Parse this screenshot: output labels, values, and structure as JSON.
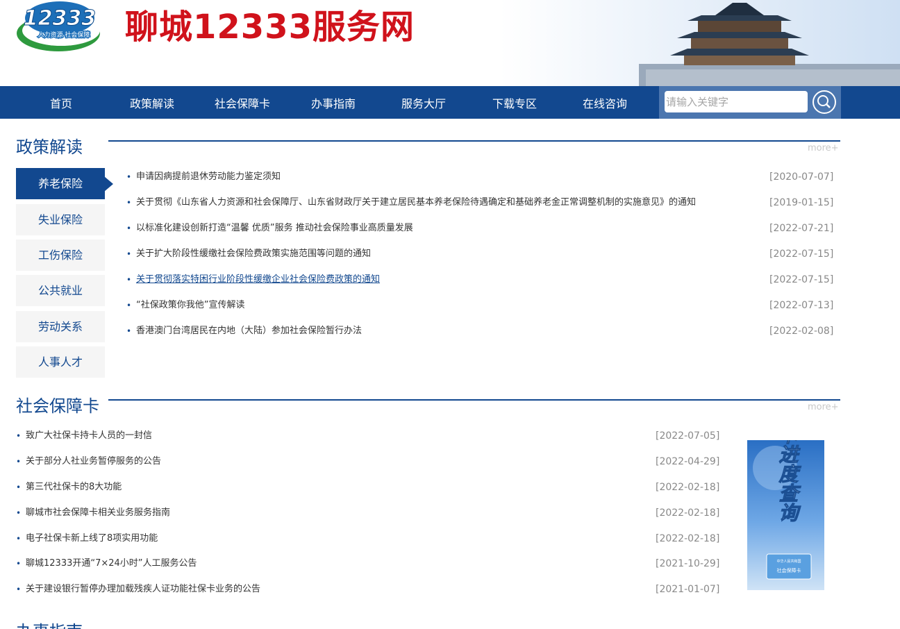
{
  "header": {
    "logo_number": "12333",
    "logo_slogan": "人力资源 社会保障",
    "site_title": "聊城12333服务网"
  },
  "nav": {
    "items": [
      "首页",
      "政策解读",
      "社会保障卡",
      "办事指南",
      "服务大厅",
      "下载专区",
      "在线咨询"
    ],
    "search_placeholder": "请输入关键字"
  },
  "policy": {
    "title": "政策解读",
    "more": "more+",
    "tabs": [
      "养老保险",
      "失业保险",
      "工伤保险",
      "公共就业",
      "劳动关系",
      "人事人才"
    ],
    "items": [
      {
        "text": "申请因病提前退休劳动能力鉴定须知",
        "date": "[2020-07-07]"
      },
      {
        "text": "关于贯彻《山东省人力资源和社会保障厅、山东省财政厅关于建立居民基本养老保险待遇确定和基础养老金正常调整机制的实施意见》的通知",
        "date": "[2019-01-15]"
      },
      {
        "text": "以标准化建设创新打造“温馨 优质”服务 推动社会保险事业高质量发展",
        "date": "[2022-07-21]"
      },
      {
        "text": "关于扩大阶段性缓缴社会保险费政策实施范围等问题的通知",
        "date": "[2022-07-15]"
      },
      {
        "text": "关于贯彻落实特困行业阶段性缓缴企业社会保险费政策的通知",
        "date": "[2022-07-15]"
      },
      {
        "text": "“社保政策你我他”宣传解读",
        "date": "[2022-07-13]"
      },
      {
        "text": "香港澳门台湾居民在内地（大陆）参加社会保险暂行办法",
        "date": "[2022-02-08]"
      }
    ]
  },
  "card": {
    "title": "社会保障卡",
    "more": "more+",
    "items": [
      {
        "text": "致广大社保卡持卡人员的一封信",
        "date": "[2022-07-05]"
      },
      {
        "text": "关于部分人社业务暂停服务的公告",
        "date": "[2022-04-29]"
      },
      {
        "text": "第三代社保卡的8大功能",
        "date": "[2022-02-18]"
      },
      {
        "text": "聊城市社会保障卡相关业务服务指南",
        "date": "[2022-02-18]"
      },
      {
        "text": "电子社保卡新上线了8项实用功能",
        "date": "[2022-02-18]"
      },
      {
        "text": "聊城12333开通“7×24小时”人工服务公告",
        "date": "[2021-10-29]"
      },
      {
        "text": "关于建设银行暂停办理加载残疾人证功能社保卡业务的公告",
        "date": "[2021-01-07]"
      }
    ],
    "banner_text": "制卡进度查询",
    "banner_small1": "中华人民共和国",
    "banner_small2": "社会保障卡"
  },
  "next_section": {
    "title": "办事指南"
  },
  "colors": {
    "brand_blue": "#12488f",
    "title_red": "#d0121b"
  }
}
